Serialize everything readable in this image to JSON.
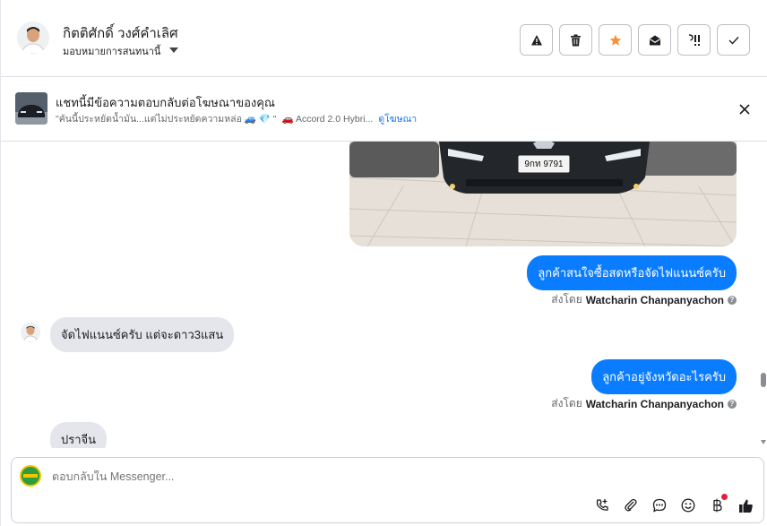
{
  "header": {
    "contact_name": "กิตติศักดิ์ วงศ์คำเลิศ",
    "assign_label": "มอบหมายการสนทนานี้",
    "actions": [
      {
        "name": "report-button",
        "icon": "warning-icon"
      },
      {
        "name": "delete-button",
        "icon": "trash-icon"
      },
      {
        "name": "star-button",
        "icon": "star-icon"
      },
      {
        "name": "mark-unread-button",
        "icon": "envelope-open-icon"
      },
      {
        "name": "follow-up-button",
        "icon": "follow-up-icon"
      },
      {
        "name": "mark-done-button",
        "icon": "check-icon"
      }
    ]
  },
  "ad_banner": {
    "title": "แชทนี้มีข้อความตอบกลับต่อโฆษณาของคุณ",
    "snippet": "\"คันนี้ประหยัดน้ำมัน...แต่ไม่ประหยัดความหล่อ 🚙 💎 \"",
    "ad_name": "🚗 Accord 2.0 Hybri...",
    "link_label": "ดูโฆษณา"
  },
  "messages": {
    "plate_text": "9กท 9791",
    "out_1": "ลูกค้าสนใจซื้อสดหรือจัดไฟแนนซ์ครับ",
    "sent_by_prefix_1": "ส่งโดย",
    "sender_1": "Watcharin Chanpanyachon",
    "in_1": "จัดไฟแนนซ์ครับ แต่จะดาว3แสน",
    "out_2": "ลูกค้าอยู่จังหวัดอะไรครับ",
    "sent_by_prefix_2": "ส่งโดย",
    "sender_2": "Watcharin Chanpanyachon",
    "in_2": "ปราจีน"
  },
  "composer": {
    "placeholder": "ตอบกลับใน Messenger...",
    "tools": [
      "call-icon",
      "attachment-icon",
      "saved-reply-icon",
      "emoji-icon",
      "payment-icon",
      "like-icon"
    ]
  },
  "colors": {
    "outgoing_bubble": "#0a7cff",
    "incoming_bubble": "#e4e6eb",
    "star": "#f7923b"
  }
}
